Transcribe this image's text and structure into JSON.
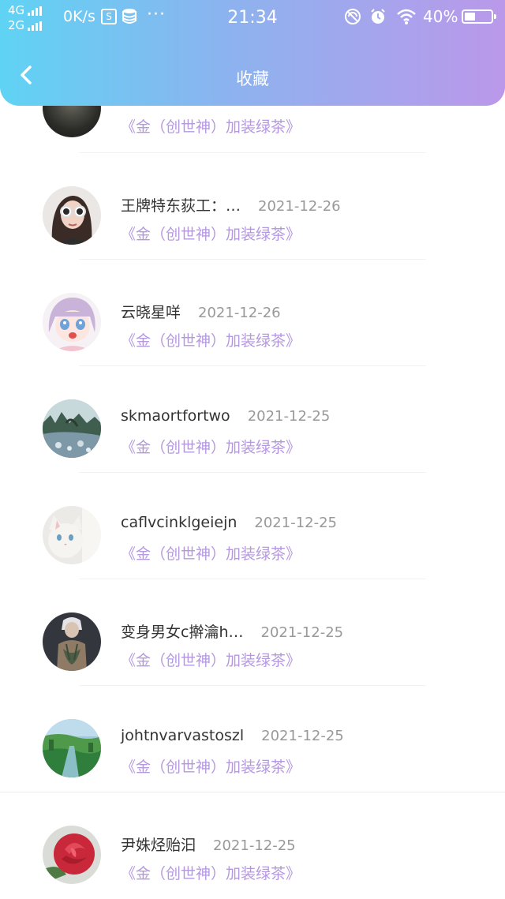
{
  "status_bar": {
    "signal_1": "4G",
    "signal_2": "2G",
    "net_speed": "0K/s",
    "s_badge": "S",
    "more": "···",
    "time": "21:34",
    "battery": "40%"
  },
  "header": {
    "title": "收藏"
  },
  "items": [
    {
      "name": "",
      "date": "",
      "book": "《金（创世神）加装绿茶》",
      "avatar": "dark-avatar"
    },
    {
      "name": "王牌特东荻工：…",
      "date": "2021-12-26",
      "book": "《金（创世神）加装绿茶》",
      "avatar": "girl-sunglasses-avatar"
    },
    {
      "name": "云晓星咩",
      "date": "2021-12-26",
      "book": "《金（创世神）加装绿茶》",
      "avatar": "anime-girl-avatar"
    },
    {
      "name": "skmaortfortwo",
      "date": "2021-12-25",
      "book": "《金（创世神）加装绿茶》",
      "avatar": "landscape-avatar"
    },
    {
      "name": "caflvcinklgeiejn",
      "date": "2021-12-25",
      "book": "《金（创世神）加装绿茶》",
      "avatar": "white-cat-avatar"
    },
    {
      "name": "变身男女c擀瀹h…",
      "date": "2021-12-25",
      "book": "《金（创世神）加装绿茶》",
      "avatar": "tattoo-man-avatar"
    },
    {
      "name": "johtnvarvastoszl",
      "date": "2021-12-25",
      "book": "《金（创世神）加装绿茶》",
      "avatar": "green-field-avatar"
    },
    {
      "name": "尹姝烃贻汩",
      "date": "2021-12-25",
      "book": "《金（创世神）加装绿茶》",
      "avatar": "red-rose-avatar"
    }
  ],
  "colors": {
    "accent_purple": "#b598e0",
    "header_start": "#5fd3f4",
    "header_end": "#bb98ea"
  }
}
